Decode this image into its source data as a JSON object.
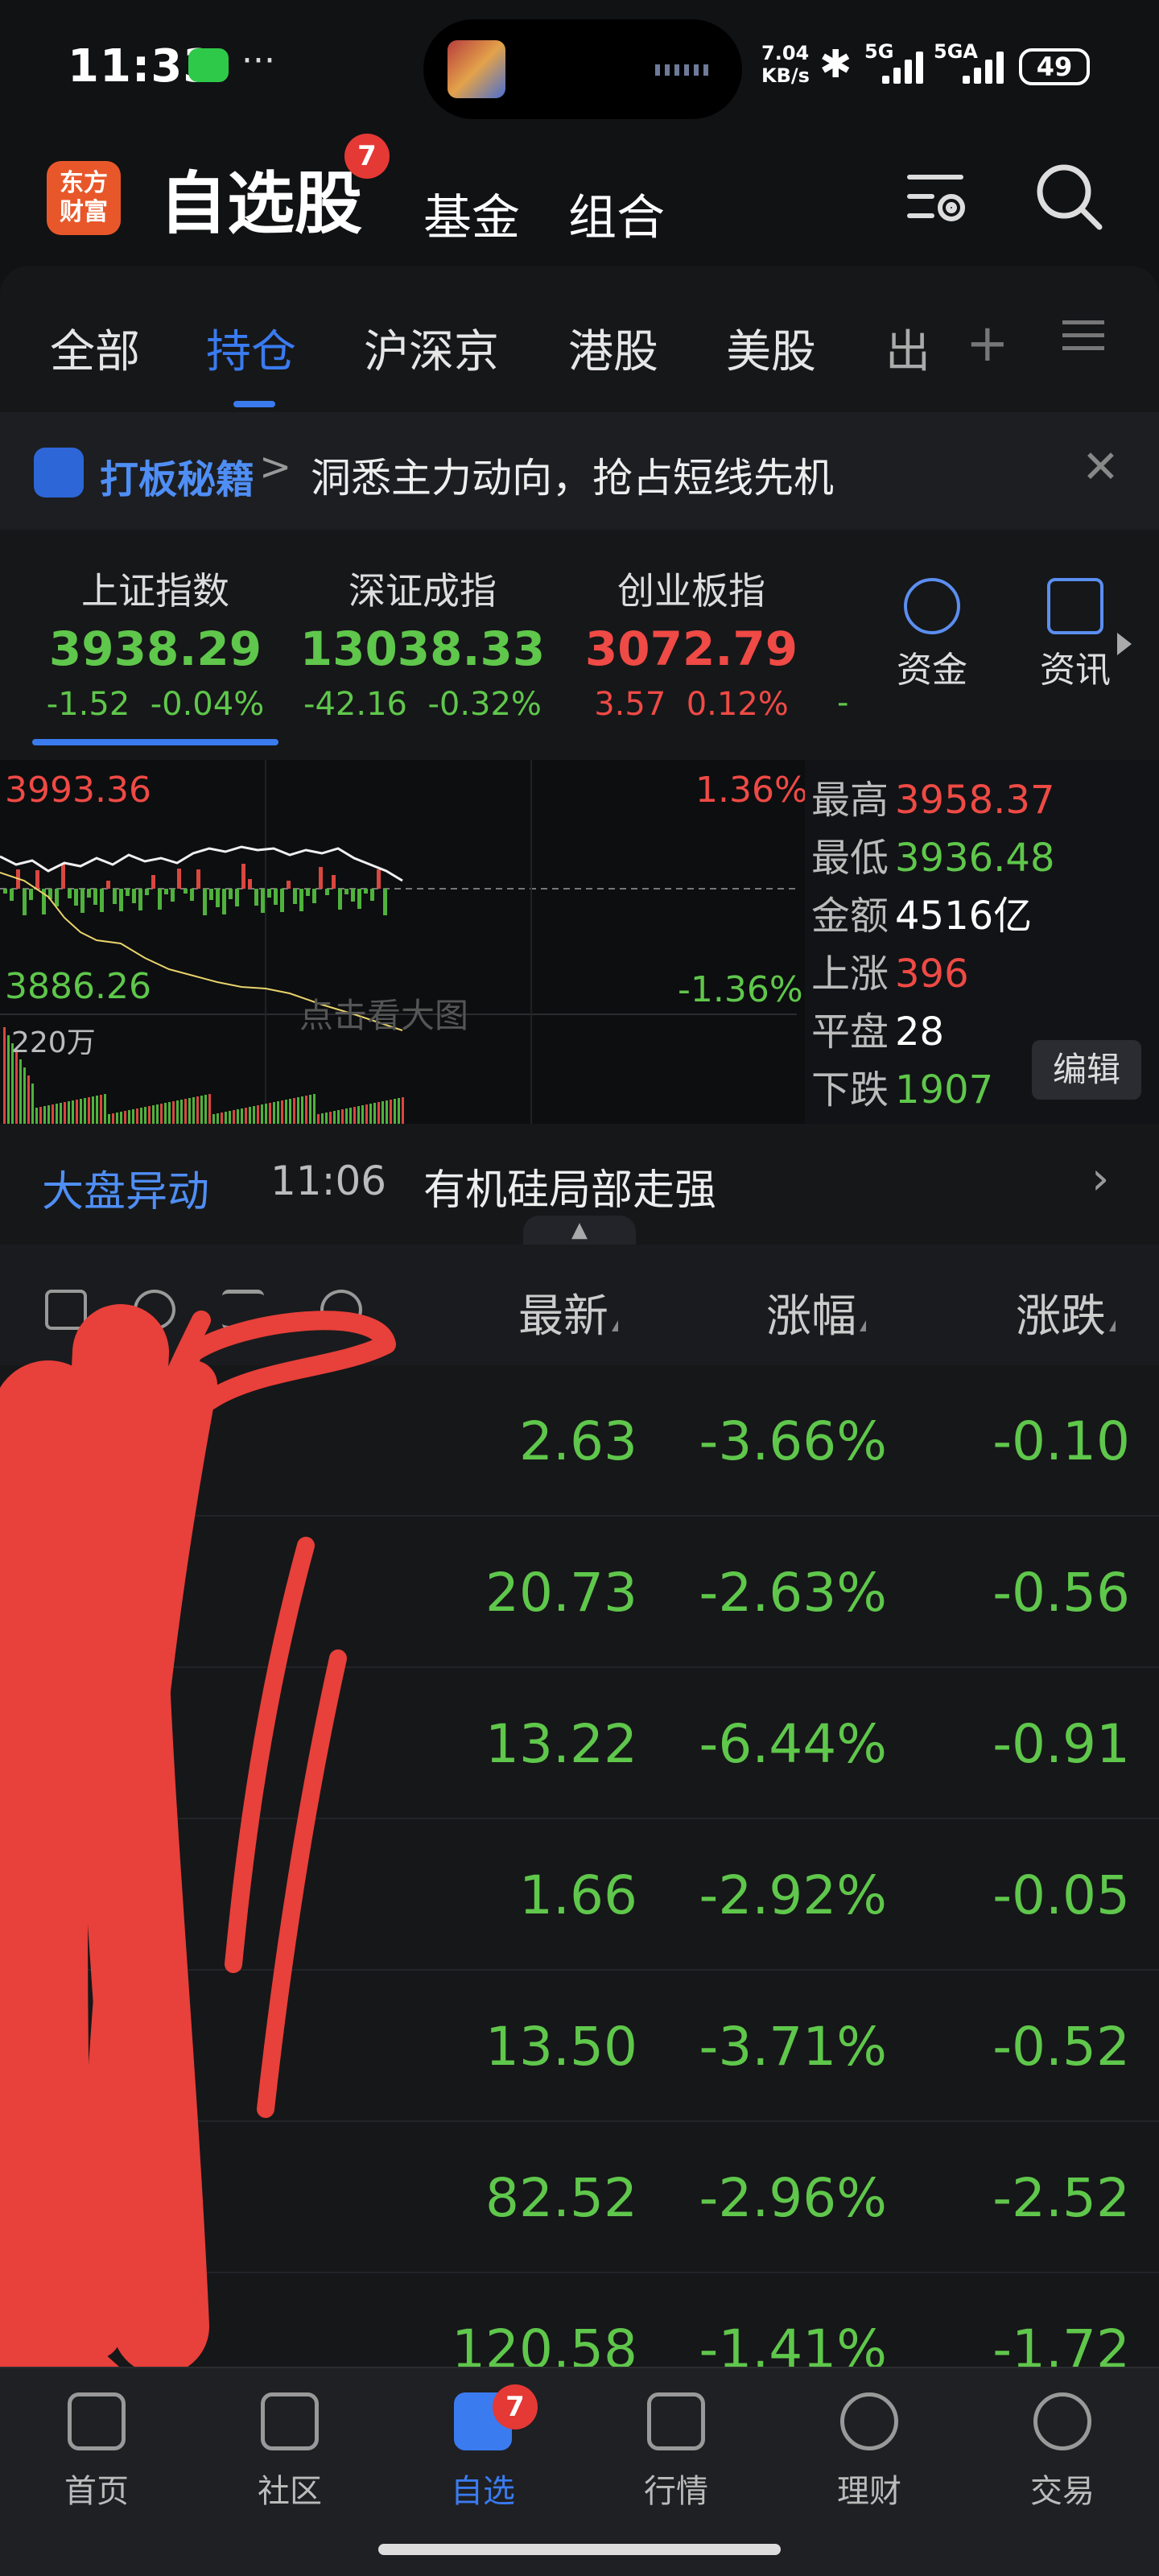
{
  "status": {
    "time": "11:33",
    "dots": "···",
    "net_speed_value": "7.04",
    "net_speed_unit": "KB/s",
    "sig1": "5G",
    "sig2": "5GA",
    "battery": "49"
  },
  "header": {
    "logo": "东方财富",
    "title": "自选股",
    "title_badge": "7",
    "tab_fund": "基金",
    "tab_combo": "组合"
  },
  "tabs": [
    "全部",
    "持仓",
    "沪深京",
    "港股",
    "美股",
    "出"
  ],
  "banner": {
    "tag": "打板秘籍",
    "chevron": ">",
    "text": "洞悉主力动向，抢占短线先机"
  },
  "indices": [
    {
      "name": "上证指数",
      "value": "3938.29",
      "change": "-1.52",
      "pct": "-0.04%",
      "trend": "down"
    },
    {
      "name": "深证成指",
      "value": "13038.33",
      "change": "-42.16",
      "pct": "-0.32%",
      "trend": "down"
    },
    {
      "name": "创业板指",
      "value": "3072.79",
      "change": "3.57",
      "pct": "0.12%",
      "trend": "up"
    }
  ],
  "index_extra": "-",
  "side_buttons": {
    "funds": "资金",
    "news": "资讯"
  },
  "chart": {
    "top_left": "3993.36",
    "top_right": "1.36%",
    "bottom_left": "3886.26",
    "bottom_right": "-1.36%",
    "volume": "220万",
    "overlay": "点击看大图",
    "stats": [
      {
        "label": "最高",
        "value": "3958.37",
        "color": "red"
      },
      {
        "label": "最低",
        "value": "3936.48",
        "color": "green"
      },
      {
        "label": "金额",
        "value": "4516亿",
        "color": "white"
      },
      {
        "label": "上涨",
        "value": "396",
        "color": "red"
      },
      {
        "label": "平盘",
        "value": "28",
        "color": "white"
      },
      {
        "label": "下跌",
        "value": "1907",
        "color": "green"
      }
    ],
    "edit": "编辑"
  },
  "alert": {
    "tag": "大盘异动",
    "time": "11:06",
    "text": "有机硅局部走强"
  },
  "list": {
    "col_latest": "最新",
    "col_pct": "涨幅",
    "col_change": "涨跌",
    "rows": [
      {
        "latest": "2.63",
        "pct": "-3.66%",
        "change": "-0.10"
      },
      {
        "latest": "20.73",
        "pct": "-2.63%",
        "change": "-0.56"
      },
      {
        "latest": "13.22",
        "pct": "-6.44%",
        "change": "-0.91"
      },
      {
        "latest": "1.66",
        "pct": "-2.92%",
        "change": "-0.05"
      },
      {
        "latest": "13.50",
        "pct": "-3.71%",
        "change": "-0.52"
      },
      {
        "latest": "82.52",
        "pct": "-2.96%",
        "change": "-2.52"
      },
      {
        "latest": "120.58",
        "pct": "-1.41%",
        "change": "-1.72"
      }
    ]
  },
  "nav": [
    {
      "label": "首页",
      "icon": "home-icon"
    },
    {
      "label": "社区",
      "icon": "community-icon"
    },
    {
      "label": "自选",
      "icon": "watchlist-icon",
      "badge": "7"
    },
    {
      "label": "行情",
      "icon": "market-icon"
    },
    {
      "label": "理财",
      "icon": "wealth-icon"
    },
    {
      "label": "交易",
      "icon": "trade-icon"
    }
  ]
}
